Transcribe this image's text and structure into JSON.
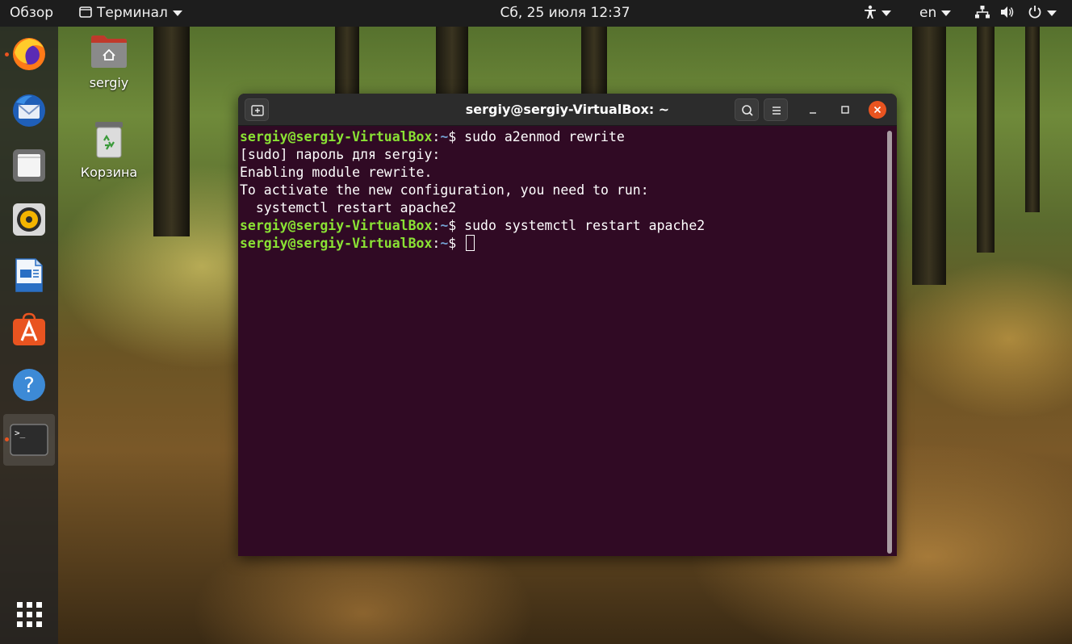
{
  "topbar": {
    "activities": "Обзор",
    "app_menu": "Терминал",
    "datetime": "Сб, 25 июля  12:37",
    "lang": "en"
  },
  "desktop": {
    "home_label": "sergiy",
    "trash_label": "Корзина"
  },
  "dock": {
    "items": [
      "firefox",
      "thunderbird",
      "files",
      "rhythmbox",
      "libreoffice-writer",
      "ubuntu-software",
      "help",
      "terminal"
    ],
    "help_glyph": "?",
    "terminal_glyph": ">_"
  },
  "terminal": {
    "title": "sergiy@sergiy-VirtualBox: ~",
    "prompt_user": "sergiy@sergiy-VirtualBox",
    "prompt_sep": ":",
    "prompt_path": "~",
    "prompt_end": "$ ",
    "cmd1": "sudo a2enmod rewrite",
    "out1": "[sudo] пароль для sergiy:",
    "out2": "Enabling module rewrite.",
    "out3": "To activate the new configuration, you need to run:",
    "out4": "  systemctl restart apache2",
    "cmd2": "sudo systemctl restart apache2"
  },
  "colors": {
    "terminal_bg": "#300a24",
    "prompt_user": "#8ae234",
    "prompt_path": "#729fcf",
    "accent": "#e95420"
  }
}
